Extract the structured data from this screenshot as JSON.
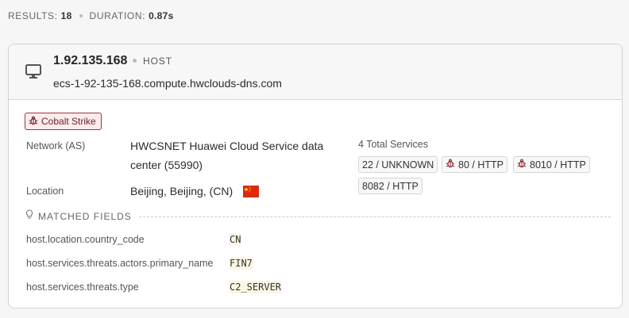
{
  "summary": {
    "results_label": "RESULTS:",
    "results_value": "18",
    "duration_label": "DURATION:",
    "duration_value": "0.87s"
  },
  "host": {
    "ip": "1.92.135.168",
    "type_label": "HOST",
    "hostname": "ecs-1-92-135-168.compute.hwclouds-dns.com",
    "icon": "monitor-icon"
  },
  "threat_tag": {
    "label": "Cobalt Strike",
    "icon": "bug-icon"
  },
  "fields": {
    "network_label": "Network (AS)",
    "network_value_line1": "HWCSNET Huawei Cloud Service data",
    "network_value_line2": "center (55990)",
    "location_label": "Location",
    "location_value": "Beijing, Beijing, (CN)",
    "flag": "china-flag"
  },
  "services": {
    "total_label": "4 Total Services",
    "items": [
      {
        "label": "22 / UNKNOWN",
        "threat": false
      },
      {
        "label": "80 / HTTP",
        "threat": true
      },
      {
        "label": "8010 / HTTP",
        "threat": true
      },
      {
        "label": "8082 / HTTP",
        "threat": false
      }
    ]
  },
  "matched": {
    "label": "MATCHED FIELDS",
    "rows": [
      {
        "key": "host.location.country_code",
        "value": "CN"
      },
      {
        "key": "host.services.threats.actors.primary_name",
        "value": "FIN7"
      },
      {
        "key": "host.services.threats.type",
        "value": "C2_SERVER"
      }
    ]
  },
  "colors": {
    "threat_border": "#a3343a",
    "threat_bg": "#fbecec",
    "highlight_bg": "#fbf6e3"
  }
}
